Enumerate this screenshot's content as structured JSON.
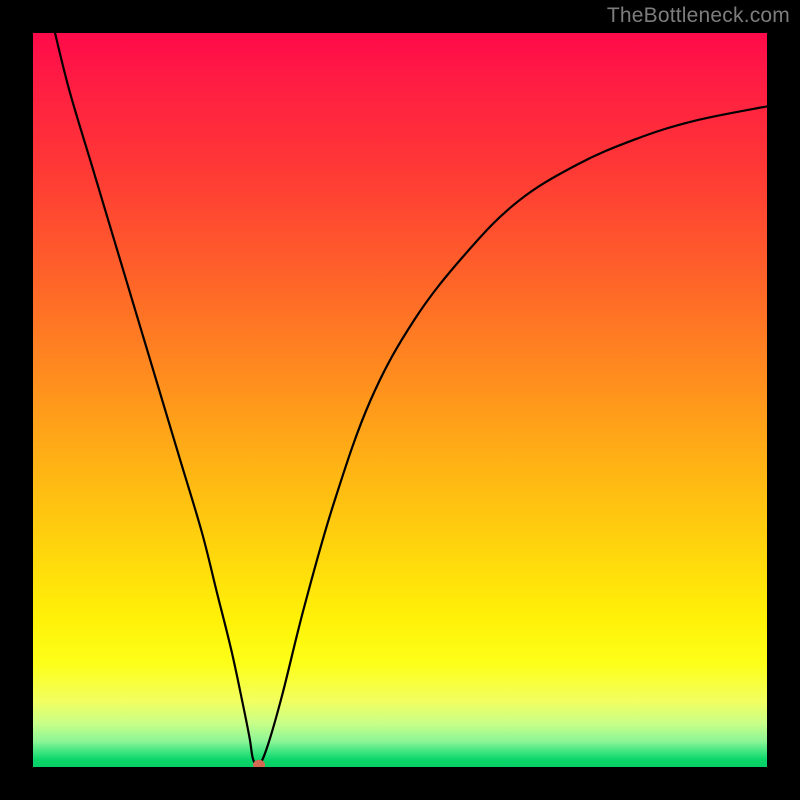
{
  "watermark": "TheBottleneck.com",
  "chart_data": {
    "type": "line",
    "title": "",
    "xlabel": "",
    "ylabel": "",
    "xlim": [
      0,
      100
    ],
    "ylim": [
      0,
      100
    ],
    "grid": false,
    "series": [
      {
        "name": "bottleneck-curve",
        "x": [
          3,
          5,
          8,
          11,
          14,
          17,
          20,
          23,
          25,
          27,
          28.5,
          29.5,
          30,
          30.8,
          32,
          34,
          37,
          41,
          46,
          52,
          59,
          66,
          74,
          82,
          90,
          100
        ],
        "y": [
          100,
          92,
          82,
          72,
          62,
          52,
          42,
          32,
          24,
          16,
          9,
          4,
          1,
          0.3,
          3,
          10,
          22,
          36,
          50,
          61,
          70,
          77,
          82,
          85.5,
          88,
          90
        ]
      }
    ],
    "minimum_marker": {
      "x": 30.8,
      "y": 0.3
    },
    "background_gradient": {
      "top": "#ff0a4a",
      "mid": "#ffd40d",
      "bottom": "#06cf65"
    }
  }
}
